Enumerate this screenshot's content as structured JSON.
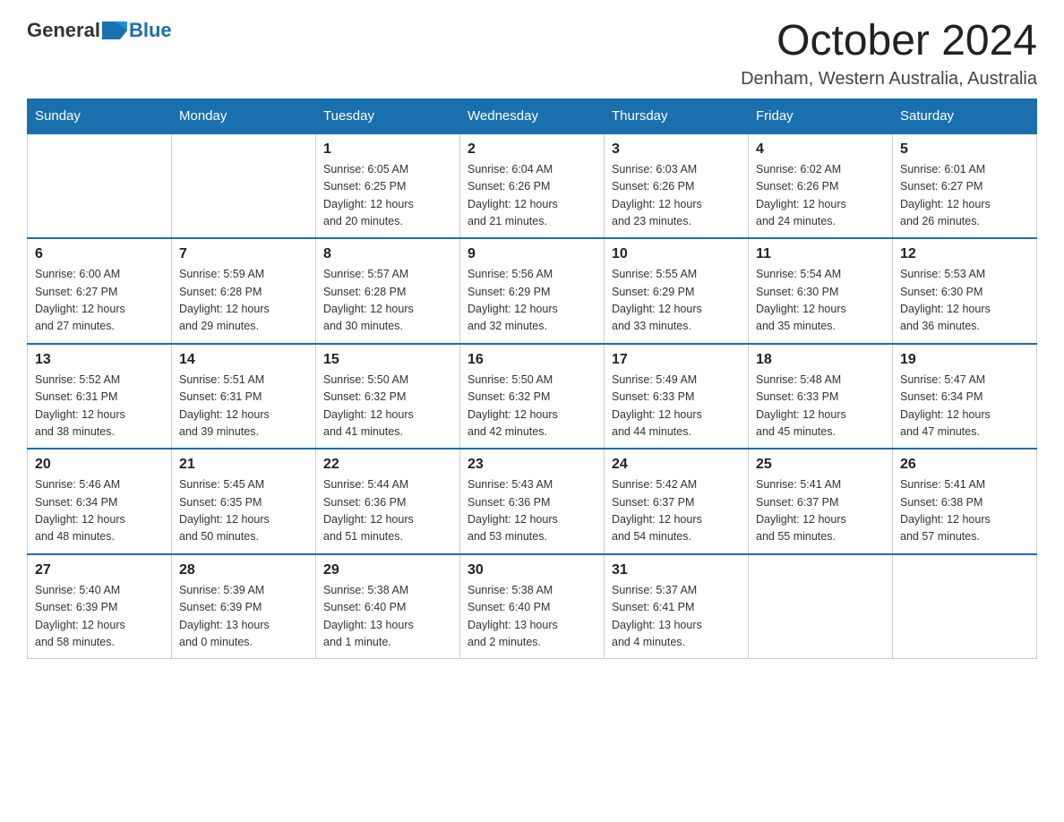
{
  "header": {
    "logo_general": "General",
    "logo_blue": "Blue",
    "month": "October 2024",
    "location": "Denham, Western Australia, Australia"
  },
  "days_of_week": [
    "Sunday",
    "Monday",
    "Tuesday",
    "Wednesday",
    "Thursday",
    "Friday",
    "Saturday"
  ],
  "weeks": [
    [
      {
        "day": "",
        "info": ""
      },
      {
        "day": "",
        "info": ""
      },
      {
        "day": "1",
        "info": "Sunrise: 6:05 AM\nSunset: 6:25 PM\nDaylight: 12 hours\nand 20 minutes."
      },
      {
        "day": "2",
        "info": "Sunrise: 6:04 AM\nSunset: 6:26 PM\nDaylight: 12 hours\nand 21 minutes."
      },
      {
        "day": "3",
        "info": "Sunrise: 6:03 AM\nSunset: 6:26 PM\nDaylight: 12 hours\nand 23 minutes."
      },
      {
        "day": "4",
        "info": "Sunrise: 6:02 AM\nSunset: 6:26 PM\nDaylight: 12 hours\nand 24 minutes."
      },
      {
        "day": "5",
        "info": "Sunrise: 6:01 AM\nSunset: 6:27 PM\nDaylight: 12 hours\nand 26 minutes."
      }
    ],
    [
      {
        "day": "6",
        "info": "Sunrise: 6:00 AM\nSunset: 6:27 PM\nDaylight: 12 hours\nand 27 minutes."
      },
      {
        "day": "7",
        "info": "Sunrise: 5:59 AM\nSunset: 6:28 PM\nDaylight: 12 hours\nand 29 minutes."
      },
      {
        "day": "8",
        "info": "Sunrise: 5:57 AM\nSunset: 6:28 PM\nDaylight: 12 hours\nand 30 minutes."
      },
      {
        "day": "9",
        "info": "Sunrise: 5:56 AM\nSunset: 6:29 PM\nDaylight: 12 hours\nand 32 minutes."
      },
      {
        "day": "10",
        "info": "Sunrise: 5:55 AM\nSunset: 6:29 PM\nDaylight: 12 hours\nand 33 minutes."
      },
      {
        "day": "11",
        "info": "Sunrise: 5:54 AM\nSunset: 6:30 PM\nDaylight: 12 hours\nand 35 minutes."
      },
      {
        "day": "12",
        "info": "Sunrise: 5:53 AM\nSunset: 6:30 PM\nDaylight: 12 hours\nand 36 minutes."
      }
    ],
    [
      {
        "day": "13",
        "info": "Sunrise: 5:52 AM\nSunset: 6:31 PM\nDaylight: 12 hours\nand 38 minutes."
      },
      {
        "day": "14",
        "info": "Sunrise: 5:51 AM\nSunset: 6:31 PM\nDaylight: 12 hours\nand 39 minutes."
      },
      {
        "day": "15",
        "info": "Sunrise: 5:50 AM\nSunset: 6:32 PM\nDaylight: 12 hours\nand 41 minutes."
      },
      {
        "day": "16",
        "info": "Sunrise: 5:50 AM\nSunset: 6:32 PM\nDaylight: 12 hours\nand 42 minutes."
      },
      {
        "day": "17",
        "info": "Sunrise: 5:49 AM\nSunset: 6:33 PM\nDaylight: 12 hours\nand 44 minutes."
      },
      {
        "day": "18",
        "info": "Sunrise: 5:48 AM\nSunset: 6:33 PM\nDaylight: 12 hours\nand 45 minutes."
      },
      {
        "day": "19",
        "info": "Sunrise: 5:47 AM\nSunset: 6:34 PM\nDaylight: 12 hours\nand 47 minutes."
      }
    ],
    [
      {
        "day": "20",
        "info": "Sunrise: 5:46 AM\nSunset: 6:34 PM\nDaylight: 12 hours\nand 48 minutes."
      },
      {
        "day": "21",
        "info": "Sunrise: 5:45 AM\nSunset: 6:35 PM\nDaylight: 12 hours\nand 50 minutes."
      },
      {
        "day": "22",
        "info": "Sunrise: 5:44 AM\nSunset: 6:36 PM\nDaylight: 12 hours\nand 51 minutes."
      },
      {
        "day": "23",
        "info": "Sunrise: 5:43 AM\nSunset: 6:36 PM\nDaylight: 12 hours\nand 53 minutes."
      },
      {
        "day": "24",
        "info": "Sunrise: 5:42 AM\nSunset: 6:37 PM\nDaylight: 12 hours\nand 54 minutes."
      },
      {
        "day": "25",
        "info": "Sunrise: 5:41 AM\nSunset: 6:37 PM\nDaylight: 12 hours\nand 55 minutes."
      },
      {
        "day": "26",
        "info": "Sunrise: 5:41 AM\nSunset: 6:38 PM\nDaylight: 12 hours\nand 57 minutes."
      }
    ],
    [
      {
        "day": "27",
        "info": "Sunrise: 5:40 AM\nSunset: 6:39 PM\nDaylight: 12 hours\nand 58 minutes."
      },
      {
        "day": "28",
        "info": "Sunrise: 5:39 AM\nSunset: 6:39 PM\nDaylight: 13 hours\nand 0 minutes."
      },
      {
        "day": "29",
        "info": "Sunrise: 5:38 AM\nSunset: 6:40 PM\nDaylight: 13 hours\nand 1 minute."
      },
      {
        "day": "30",
        "info": "Sunrise: 5:38 AM\nSunset: 6:40 PM\nDaylight: 13 hours\nand 2 minutes."
      },
      {
        "day": "31",
        "info": "Sunrise: 5:37 AM\nSunset: 6:41 PM\nDaylight: 13 hours\nand 4 minutes."
      },
      {
        "day": "",
        "info": ""
      },
      {
        "day": "",
        "info": ""
      }
    ]
  ]
}
